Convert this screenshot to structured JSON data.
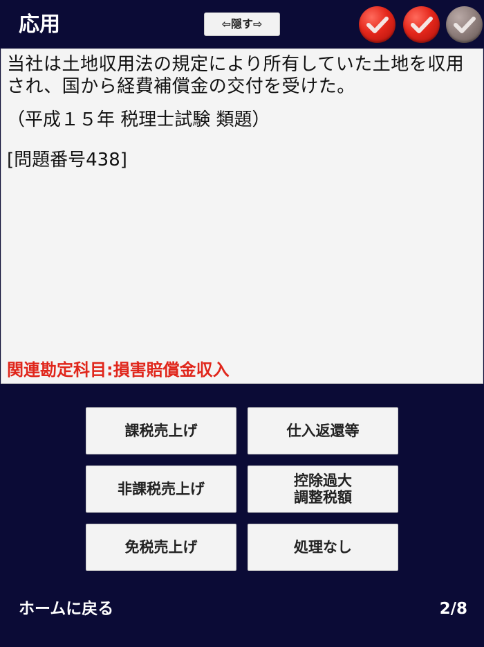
{
  "header": {
    "title": "応用",
    "hide_label": "⇦隠す⇨",
    "progress_marks": [
      {
        "state": "correct",
        "color": "#e4271b",
        "icon": "check-icon"
      },
      {
        "state": "correct",
        "color": "#e4271b",
        "icon": "check-icon"
      },
      {
        "state": "unanswered",
        "color": "#8d7d7a",
        "icon": "check-icon"
      }
    ]
  },
  "question": {
    "text": "当社は土地収用法の規定により所有していた土地を収用され、国から経費補償金の交付を受けた。",
    "source": "（平成１５年 税理士試験 類題）",
    "number": "[問題番号438]",
    "related_subject": "関連勘定科目:損害賠償金収入"
  },
  "answers": [
    {
      "label": "課税売上げ"
    },
    {
      "label": "仕入返還等"
    },
    {
      "label": "非課税売上げ"
    },
    {
      "label": "控除過大\n調整税額"
    },
    {
      "label": "免税売上げ"
    },
    {
      "label": "処理なし"
    }
  ],
  "footer": {
    "home_label": "ホームに戻る",
    "page_indicator": "2/8"
  },
  "colors": {
    "background": "#0b0b36",
    "panel": "#f4f4f4",
    "accent_red": "#e0261b"
  }
}
